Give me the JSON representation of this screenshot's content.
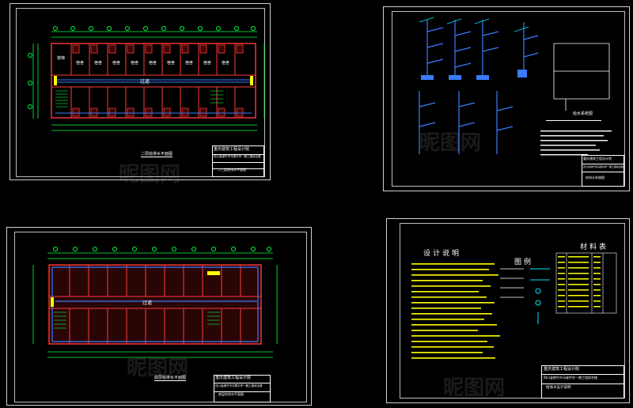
{
  "sheets": {
    "top_left": {
      "room_labels": [
        "楼梯",
        "宿舍",
        "宿舍",
        "宿舍",
        "宿舍",
        "宿舍",
        "宿舍",
        "宿舍",
        "宿舍",
        "宿舍"
      ],
      "corridor_label": "过道",
      "caption": "二层给排水平面图",
      "title_block": {
        "org": "重庆建筑工程设计院",
        "project": "四川省绵竹市马尾中学一期工程综合楼",
        "drawing": "二三层给排水平面图"
      }
    },
    "top_right": {
      "caption": "给水系统图",
      "notes_lines": 6,
      "title_block": {
        "org": "重庆建筑工程设计院",
        "project": "四川省绵竹市马尾中学一期工程综合楼",
        "drawing": "给排水系统图"
      }
    },
    "bottom_left": {
      "corridor_label": "过道",
      "caption": "底层给排水平面图",
      "title_block": {
        "org": "重庆建筑工程设计院",
        "project": "四川省绵竹市马尾中学一期工程综合楼",
        "drawing": "底层给排水平面图"
      }
    },
    "bottom_right": {
      "heading_notes": "设计说明",
      "heading_legend": "图例",
      "heading_materials": "材料表",
      "title_block": {
        "org": "重庆建筑工程设计院",
        "project": "四川省绵竹市马尾中学一期工程综合楼",
        "drawing": "给排水设计说明"
      }
    }
  },
  "watermark": "昵图网",
  "colors": {
    "background": "#000000",
    "frame": "#cfcfcf",
    "wall": "#ff3a3a",
    "pipe": "#3a7bff",
    "dimension": "#00ff40",
    "text": "#ffffff",
    "yellow": "#ffff00",
    "cyan": "#00e5ff"
  }
}
